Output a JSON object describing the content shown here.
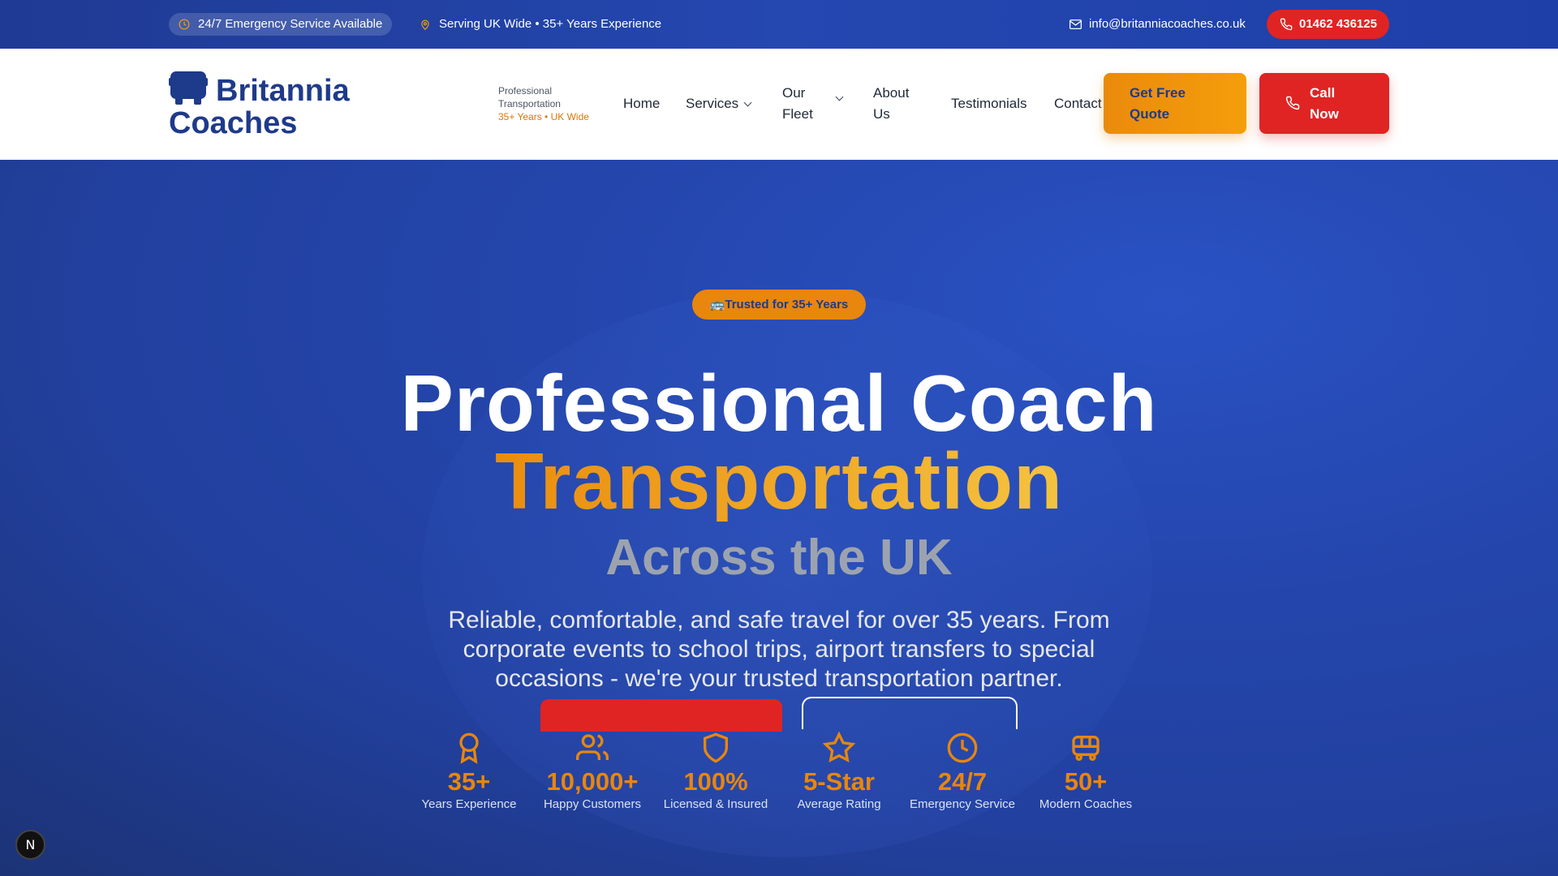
{
  "topbar": {
    "emergency": "24/7 Emergency Service Available",
    "location": "Serving UK Wide • 35+ Years Experience",
    "email": "info@britanniacoaches.co.uk",
    "phone": "01462 436125",
    "icons": [
      "clock-icon",
      "map-pin-icon",
      "mail-icon",
      "phone-icon"
    ]
  },
  "nav": {
    "logo_line1": "Britannia",
    "logo_line2": "Coaches",
    "tagline_line1": "Professional",
    "tagline_line2": "Transportation",
    "tagline_accent": "35+ Years • UK Wide",
    "links": [
      "Home",
      "Services",
      "Our",
      "Fleet",
      "About",
      "Us",
      "Testimonials",
      "Contact"
    ],
    "quote_line1": "Get Free",
    "quote_line2": "Quote",
    "call_line1": "Call",
    "call_line2": "Now"
  },
  "hero": {
    "badge": "🚌Trusted for 35+ Years",
    "title_line1": "Professional Coach",
    "title_line2": "Transportation",
    "title_line3": "Across the UK",
    "lead": "Reliable, comfortable, and safe travel for over 35 years. From corporate events to school trips, airport transfers to special occasions - we're your trusted transportation partner.",
    "stats": [
      {
        "icon": "award-icon",
        "value": "35+",
        "label": "Years Experience"
      },
      {
        "icon": "users-icon",
        "value": "10,000+",
        "label": "Happy Customers"
      },
      {
        "icon": "shield-icon",
        "value": "100%",
        "label": "Licensed & Insured"
      },
      {
        "icon": "star-icon",
        "value": "5-Star",
        "label": "Average Rating"
      },
      {
        "icon": "clock-icon",
        "value": "24/7",
        "label": "Emergency Service"
      },
      {
        "icon": "bus-icon",
        "value": "50+",
        "label": "Modern Coaches"
      }
    ]
  },
  "colors": {
    "brand_blue": "#1e3a8a",
    "accent_orange": "#e8860d",
    "cta_red": "#e02424"
  },
  "dev_badge": "N"
}
